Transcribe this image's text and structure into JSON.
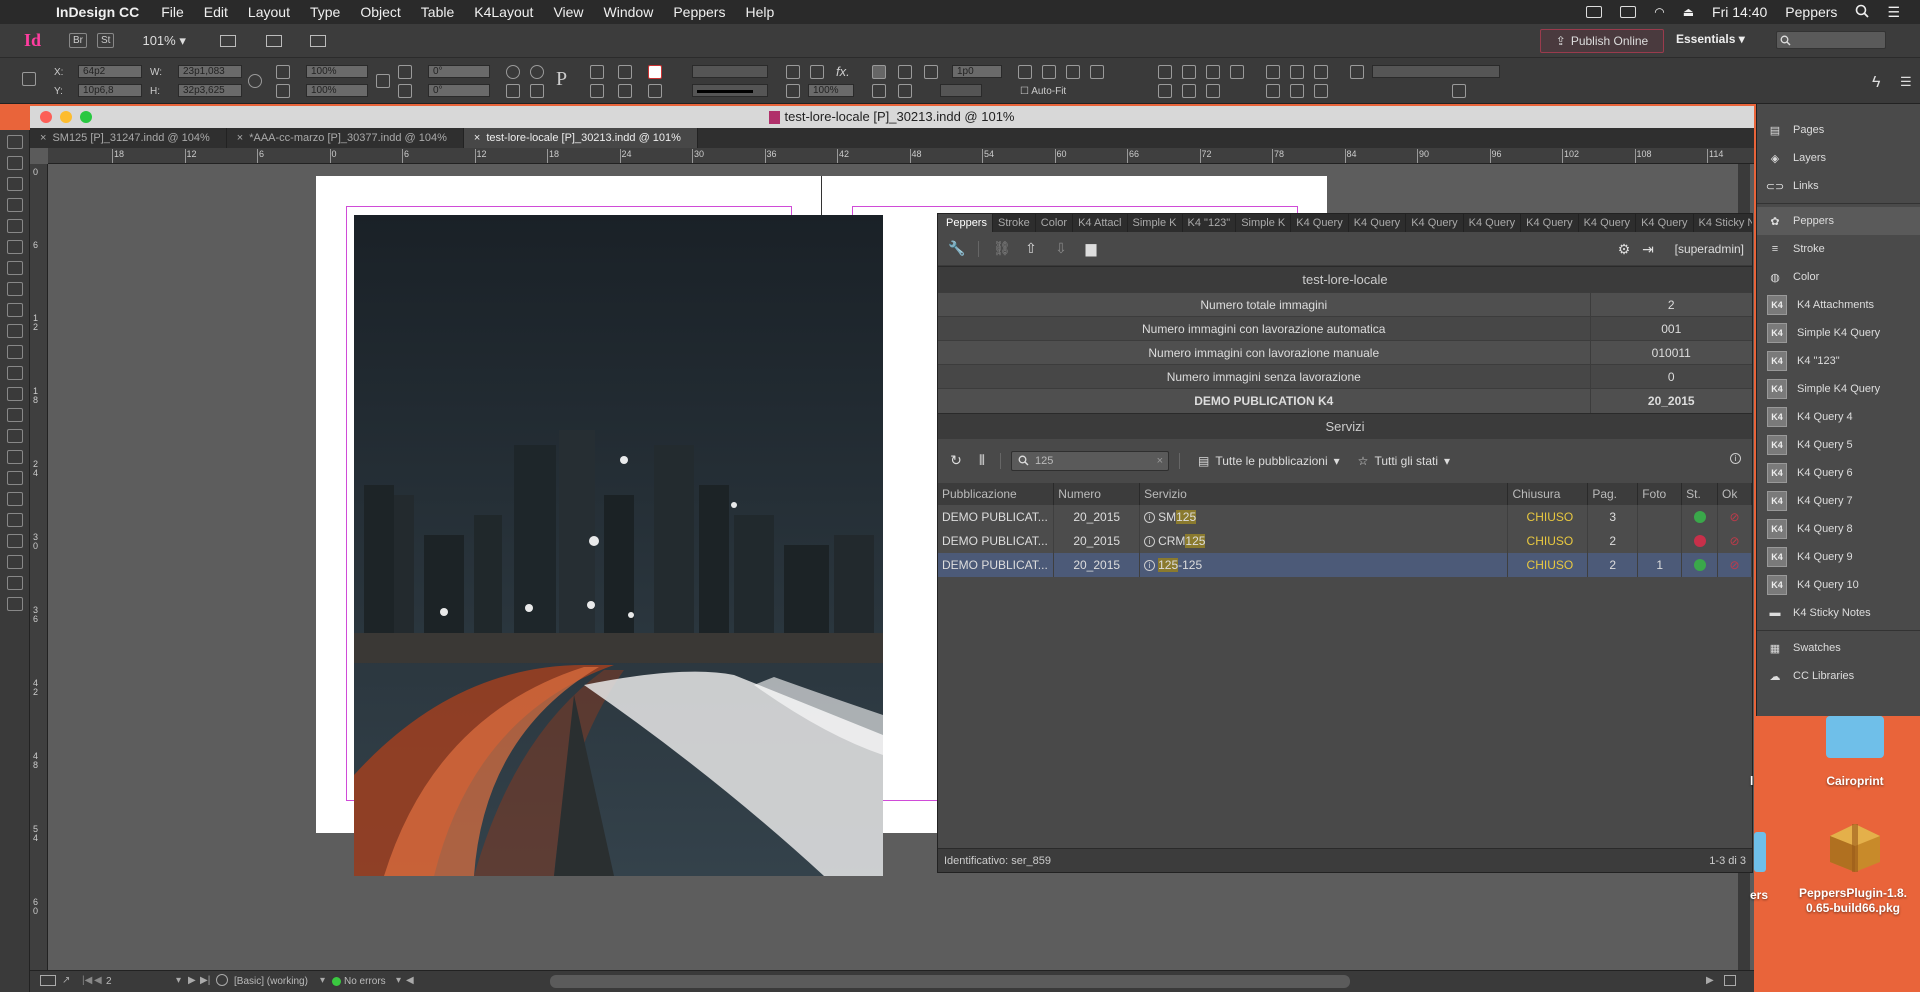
{
  "menubar": {
    "app": "InDesign CC",
    "items": [
      "File",
      "Edit",
      "Layout",
      "Type",
      "Object",
      "Table",
      "K4Layout",
      "View",
      "Window",
      "Peppers",
      "Help"
    ],
    "time": "Fri 14:40",
    "user": "Peppers"
  },
  "appbar": {
    "logo": "Id",
    "br": "Br",
    "st": "St",
    "zoom": "101%",
    "publish": "Publish Online",
    "workspace": "Essentials"
  },
  "control": {
    "x_label": "X:",
    "x_val": "64p2",
    "y_label": "Y:",
    "y_val": "10p6,8",
    "w_label": "W:",
    "w_val": "23p1,083",
    "h_label": "H:",
    "h_val": "32p3,625",
    "scale_x": "100%",
    "scale_y": "100%",
    "angle1": "0°",
    "angle2": "0°",
    "stroke_w": "1p0",
    "opacity": "100%",
    "autofit": "Auto-Fit"
  },
  "window": {
    "title": "test-lore-locale [P]_30213.indd @ 101%",
    "tabs": [
      "SM125 [P]_31247.indd @ 104%",
      "*AAA-cc-marzo [P]_30377.indd @ 104%",
      "test-lore-locale [P]_30213.indd @ 101%"
    ]
  },
  "ruler_h": [
    "18",
    "12",
    "6",
    "0",
    "6",
    "12",
    "18",
    "24",
    "30",
    "36",
    "42",
    "48",
    "54",
    "60",
    "66",
    "72",
    "78",
    "84",
    "90",
    "96",
    "102",
    "108",
    "114"
  ],
  "ruler_v": [
    "0",
    "6",
    "1 2",
    "1 8",
    "2 4",
    "3 0",
    "3 6",
    "4 2",
    "4 8",
    "5 4",
    "6 0"
  ],
  "status": {
    "page": "2",
    "style": "[Basic] (working)",
    "errors": "No errors"
  },
  "peppers": {
    "tabs": [
      "Peppers",
      "Stroke",
      "Color",
      "K4 Attacl",
      "Simple K",
      "K4 \"123\"",
      "Simple K",
      "K4 Query",
      "K4 Query",
      "K4 Query",
      "K4 Query",
      "K4 Query",
      "K4 Query",
      "K4 Query",
      "K4 Sticky N"
    ],
    "user": "[superadmin]",
    "doc_title": "test-lore-locale",
    "stats": [
      {
        "label": "Numero totale immagini",
        "value": "2"
      },
      {
        "label": "Numero immagini con lavorazione automatica",
        "value": "001"
      },
      {
        "label": "Numero immagini con lavorazione manuale",
        "value": "010011"
      },
      {
        "label": "Numero immagini senza lavorazione",
        "value": "0"
      },
      {
        "label": "DEMO PUBLICATION K4",
        "value": "20_2015"
      }
    ],
    "services_title": "Servizi",
    "search_value": "125",
    "filter_pub": "Tutte le pubblicazioni",
    "filter_state": "Tutti gli stati",
    "columns": [
      "Pubblicazione",
      "Numero",
      "Servizio",
      "Chiusura",
      "Pag.",
      "Foto",
      "St.",
      "Ok"
    ],
    "rows": [
      {
        "pub": "DEMO PUBLICAT...",
        "num": "20_2015",
        "serv_pre": "SM",
        "serv_hl": "125",
        "serv_post": "",
        "chiusura": "CHIUSO",
        "pag": "3",
        "foto": "",
        "st_color": "#3aa84a"
      },
      {
        "pub": "DEMO PUBLICAT...",
        "num": "20_2015",
        "serv_pre": "CRM",
        "serv_hl": "125",
        "serv_post": "",
        "chiusura": "CHIUSO",
        "pag": "2",
        "foto": "",
        "st_color": "#c8304a"
      },
      {
        "pub": "DEMO PUBLICAT...",
        "num": "20_2015",
        "serv_pre": "",
        "serv_hl": "125",
        "serv_post": "-125",
        "chiusura": "CHIUSO",
        "pag": "2",
        "foto": "1",
        "st_color": "#3aa84a"
      }
    ],
    "footer_left": "Identificativo: ser_859",
    "footer_right": "1-3 di 3"
  },
  "dock": {
    "items": [
      {
        "label": "Pages",
        "icon": "pages-icon",
        "k4": false
      },
      {
        "label": "Layers",
        "icon": "layers-icon",
        "k4": false
      },
      {
        "label": "Links",
        "icon": "links-icon",
        "k4": false
      },
      {
        "label": "Peppers",
        "icon": "peppers-icon",
        "k4": false
      },
      {
        "label": "Stroke",
        "icon": "stroke-icon",
        "k4": false
      },
      {
        "label": "Color",
        "icon": "color-icon",
        "k4": false
      },
      {
        "label": "K4 Attachments",
        "icon": "attachments-icon",
        "k4": true
      },
      {
        "label": "Simple K4 Query",
        "icon": "k4-icon",
        "k4": true
      },
      {
        "label": "K4 \"123\"",
        "icon": "k4-icon",
        "k4": true
      },
      {
        "label": "Simple K4 Query",
        "icon": "k4-icon",
        "k4": true
      },
      {
        "label": "K4 Query  4",
        "icon": "k4-icon",
        "k4": true
      },
      {
        "label": "K4 Query  5",
        "icon": "k4-icon",
        "k4": true
      },
      {
        "label": "K4 Query  6",
        "icon": "k4-icon",
        "k4": true
      },
      {
        "label": "K4 Query  7",
        "icon": "k4-icon",
        "k4": true
      },
      {
        "label": "K4 Query  8",
        "icon": "k4-icon",
        "k4": true
      },
      {
        "label": "K4 Query  9",
        "icon": "k4-icon",
        "k4": true
      },
      {
        "label": "K4 Query 10",
        "icon": "k4-icon",
        "k4": true
      },
      {
        "label": "K4 Sticky Notes",
        "icon": "sticky-notes-icon",
        "k4": false
      },
      {
        "label": "Swatches",
        "icon": "swatches-icon",
        "k4": false
      },
      {
        "label": "CC Libraries",
        "icon": "cc-libraries-icon",
        "k4": false
      }
    ]
  },
  "desktop": {
    "folder_label": "Cairoprint",
    "pkg_label_1": "PeppersPlugin-1.8.",
    "pkg_label_2": "0.65-build66.pkg",
    "cut_label_1": "l",
    "cut_label_2": "ers"
  },
  "colors": {
    "desktop": "#e9643a",
    "margin": "#d04bd8",
    "highlight": "#8a7a2e",
    "chiuso": "#e8c840"
  }
}
